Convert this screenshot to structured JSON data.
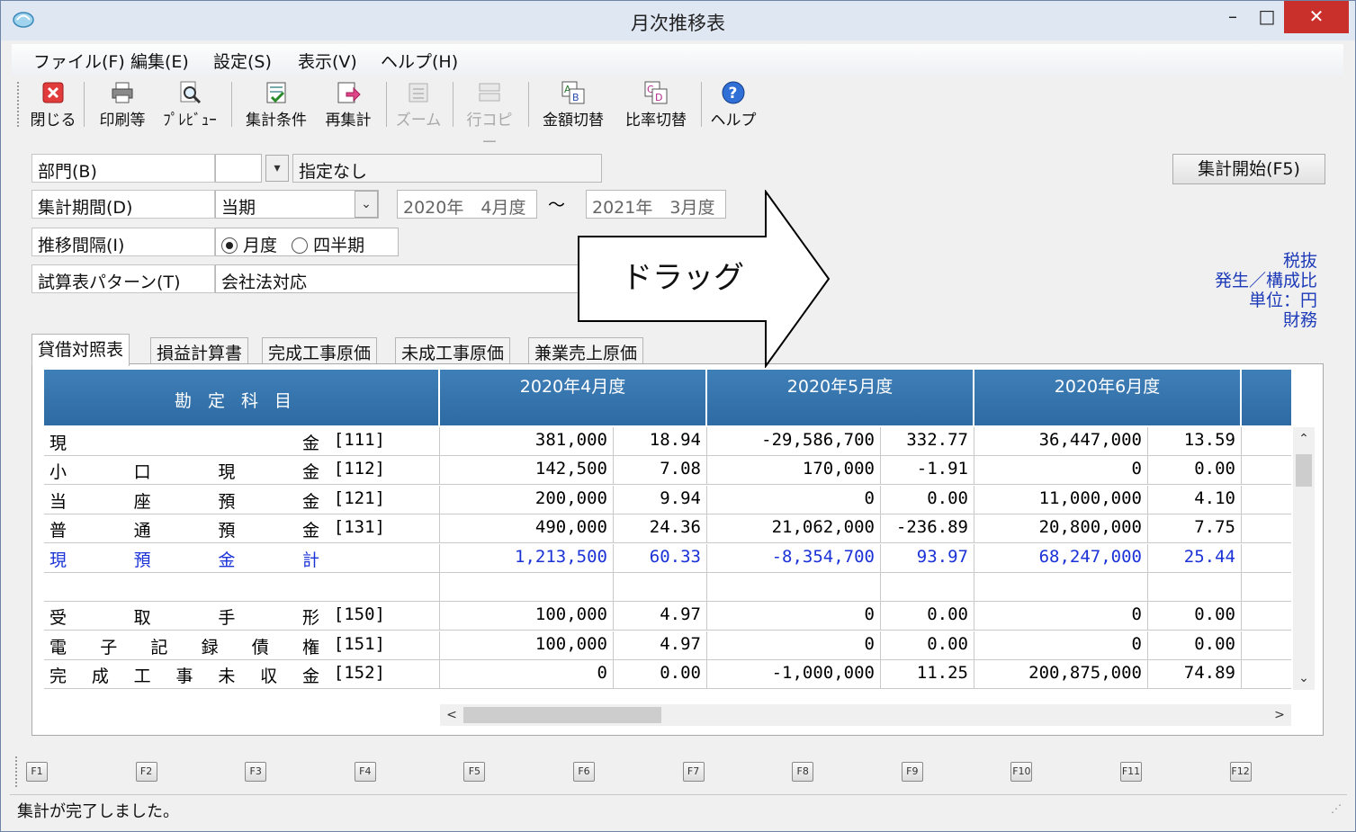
{
  "window": {
    "title": "月次推移表"
  },
  "window_controls": {
    "minimize": "–",
    "maximize": "□",
    "close": "✕"
  },
  "menu": [
    {
      "label": "ファイル(F)"
    },
    {
      "label": "編集(E)"
    },
    {
      "label": "設定(S)"
    },
    {
      "label": "表示(V)"
    },
    {
      "label": "ヘルプ(H)"
    }
  ],
  "toolbar": {
    "close": "閉じる",
    "print": "印刷等",
    "preview": "ﾌﾟﾚﾋﾞｭｰ",
    "conditions": "集計条件",
    "recalc": "再集計",
    "zoom": "ズーム",
    "row_copy": "行コピー",
    "amount_toggle": "金額切替",
    "ratio_toggle": "比率切替",
    "help": "ヘルプ"
  },
  "form": {
    "department_label": "部門(B)",
    "department_code": "",
    "department_value": "指定なし",
    "period_label": "集計期間(D)",
    "period_select": "当期",
    "period_from": "2020年　4月度",
    "period_sep": "～",
    "period_to": "2021年　3月度",
    "interval_label": "推移間隔(I)",
    "interval_opt1": "月度",
    "interval_opt2": "四半期",
    "pattern_label": "試算表パターン(T)",
    "pattern_value": "会社法対応",
    "start_button": "集計開始(F5)"
  },
  "info": {
    "line1": "税抜",
    "line2": "発生／構成比",
    "line3": "単位：円",
    "line4": "財務"
  },
  "tabs": [
    {
      "label": "貸借対照表"
    },
    {
      "label": "損益計算書"
    },
    {
      "label": "完成工事原価"
    },
    {
      "label": "未成工事原価"
    },
    {
      "label": "兼業売上原価"
    }
  ],
  "grid": {
    "header_account": "勘定科目",
    "months": [
      "2020年4月度",
      "2020年5月度",
      "2020年6月度"
    ],
    "rows": [
      {
        "name": [
          "現",
          "金"
        ],
        "code": "[111]",
        "v": [
          "381,000",
          "18.94",
          "-29,586,700",
          "332.77",
          "36,447,000",
          "13.59"
        ]
      },
      {
        "name": [
          "小",
          "口",
          "現",
          "金"
        ],
        "code": "[112]",
        "v": [
          "142,500",
          "7.08",
          "170,000",
          "-1.91",
          "0",
          "0.00"
        ]
      },
      {
        "name": [
          "当",
          "座",
          "預",
          "金"
        ],
        "code": "[121]",
        "v": [
          "200,000",
          "9.94",
          "0",
          "0.00",
          "11,000,000",
          "4.10"
        ]
      },
      {
        "name": [
          "普",
          "通",
          "預",
          "金"
        ],
        "code": "[131]",
        "v": [
          "490,000",
          "24.36",
          "21,062,000",
          "-236.89",
          "20,800,000",
          "7.75"
        ]
      },
      {
        "name": [
          "現",
          "預",
          "金",
          "計"
        ],
        "code": "",
        "blue": true,
        "v": [
          "1,213,500",
          "60.33",
          "-8,354,700",
          "93.97",
          "68,247,000",
          "25.44"
        ]
      },
      {
        "name": [],
        "code": "",
        "v": [
          "",
          "",
          "",
          "",
          "",
          ""
        ]
      },
      {
        "name": [
          "受",
          "取",
          "手",
          "形"
        ],
        "code": "[150]",
        "v": [
          "100,000",
          "4.97",
          "0",
          "0.00",
          "0",
          "0.00"
        ]
      },
      {
        "name": [
          "電",
          "子",
          "記",
          "録",
          "債",
          "権"
        ],
        "code": "[151]",
        "v": [
          "100,000",
          "4.97",
          "0",
          "0.00",
          "0",
          "0.00"
        ]
      },
      {
        "name": [
          "完",
          "成",
          "工",
          "事",
          "未",
          "収",
          "金"
        ],
        "code": "[152]",
        "v": [
          "0",
          "0.00",
          "-1,000,000",
          "11.25",
          "200,875,000",
          "74.89"
        ]
      }
    ]
  },
  "fkeys": [
    "F1",
    "F2",
    "F3",
    "F4",
    "F5",
    "F6",
    "F7",
    "F8",
    "F9",
    "F10",
    "F11",
    "F12"
  ],
  "status": {
    "message": "集計が完了しました。"
  },
  "annotation": {
    "text": "ドラッグ"
  }
}
